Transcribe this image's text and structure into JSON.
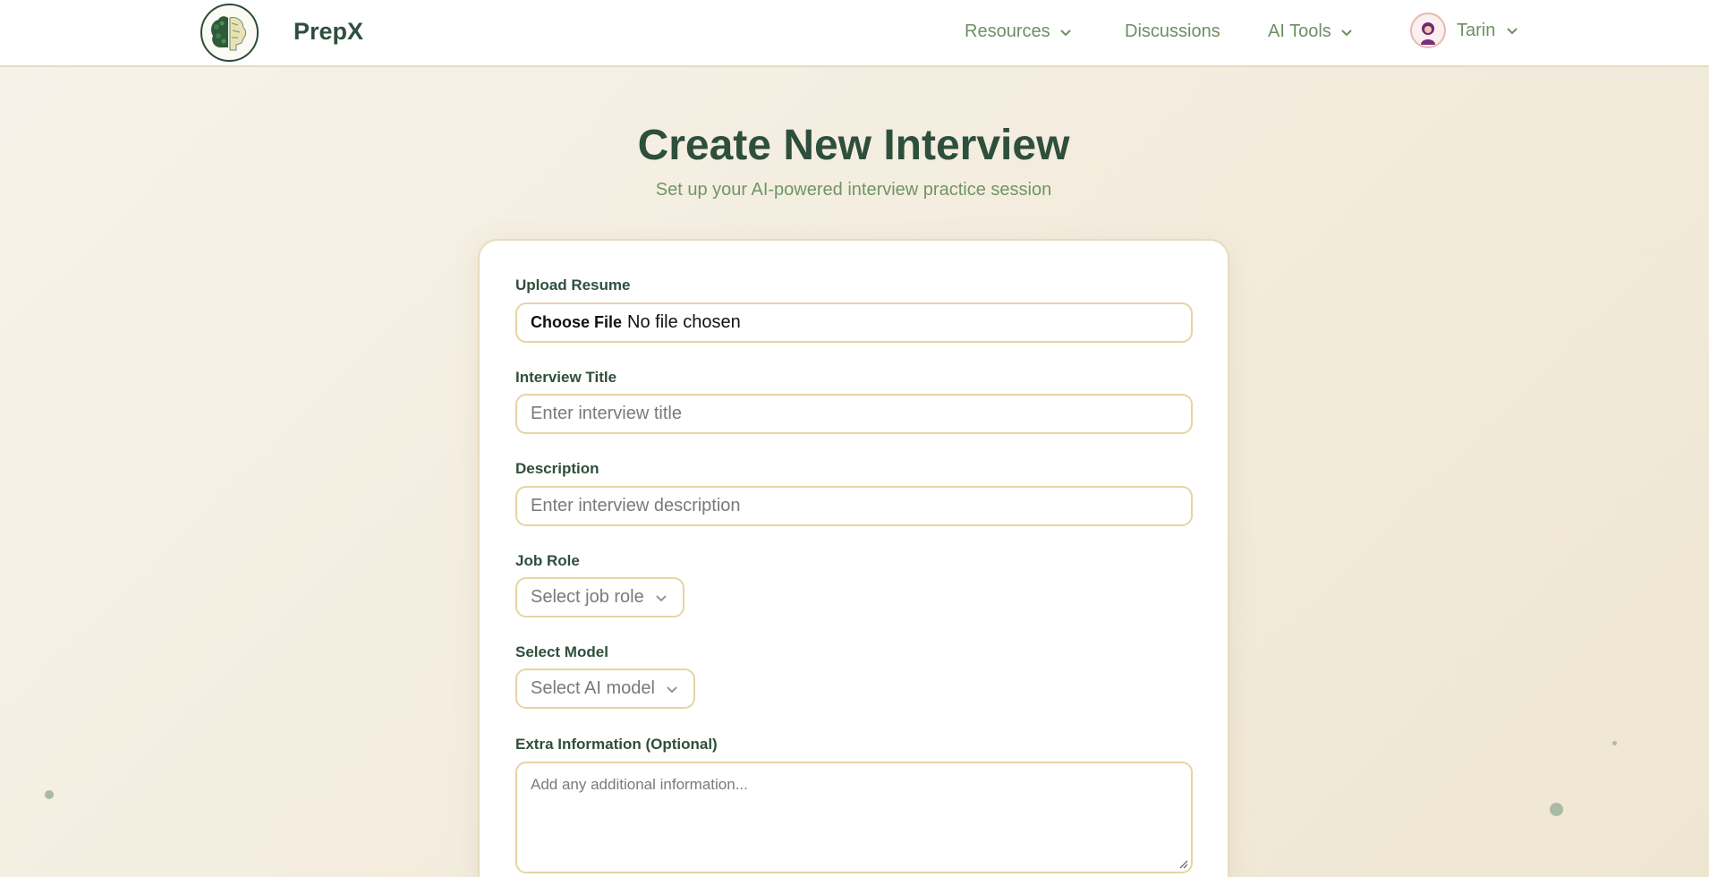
{
  "navbar": {
    "brand": "PrepX",
    "items": [
      {
        "label": "Resources",
        "has_dropdown": true
      },
      {
        "label": "Discussions",
        "has_dropdown": false
      },
      {
        "label": "AI Tools",
        "has_dropdown": true
      }
    ],
    "user": {
      "name": "Tarin",
      "icon": "user-avatar"
    }
  },
  "page": {
    "title": "Create New Interview",
    "subtitle": "Set up your AI-powered interview practice session"
  },
  "form": {
    "upload": {
      "label": "Upload Resume",
      "button": "Choose File",
      "status": "No file chosen"
    },
    "title": {
      "label": "Interview Title",
      "placeholder": "Enter interview title"
    },
    "description": {
      "label": "Description",
      "placeholder": "Enter interview description"
    },
    "job_role": {
      "label": "Job Role",
      "placeholder": "Select job role"
    },
    "model": {
      "label": "Select Model",
      "placeholder": "Select AI model"
    },
    "extra": {
      "label": "Extra Information (Optional)",
      "placeholder": "Add any additional information..."
    }
  },
  "colors": {
    "primary_green": "#2e4f3c",
    "muted_green": "#6f9565",
    "border_gold": "#e6d4a4",
    "background": "#f5efe2"
  }
}
